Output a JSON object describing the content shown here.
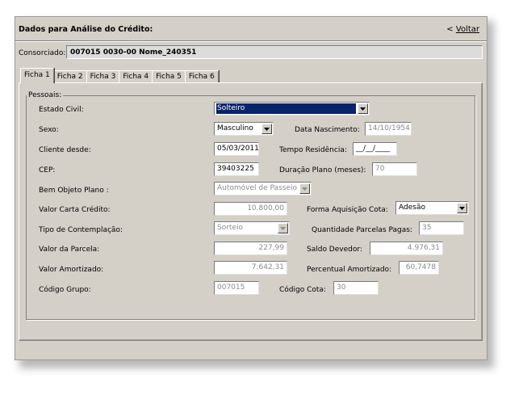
{
  "window": {
    "title": "Dados para Análise do Crédito:",
    "back_label": "Voltar",
    "back_glyph": "<"
  },
  "consorciado": {
    "label": "Consorciado:",
    "value": "007015 0030-00  Nome_240351"
  },
  "tabs": [
    {
      "label": "Ficha 1",
      "active": true
    },
    {
      "label": "Ficha 2"
    },
    {
      "label": "Ficha 3"
    },
    {
      "label": "Ficha 4"
    },
    {
      "label": "Ficha 5"
    },
    {
      "label": "Ficha 6"
    }
  ],
  "group": {
    "legend": "Pessoais:"
  },
  "fields": {
    "estado_civil": {
      "label": "Estado Civil:",
      "value": "Solteiro"
    },
    "sexo": {
      "label": "Sexo:",
      "value": "Masculino"
    },
    "data_nascimento": {
      "label": "Data Nascimento:",
      "value": "14/10/1954"
    },
    "cliente_desde": {
      "label": "Cliente desde:",
      "value": "05/03/2011"
    },
    "tempo_residencia": {
      "label": "Tempo Residência:",
      "value": "__/__/____"
    },
    "cep": {
      "label": "CEP:",
      "value": "39403225"
    },
    "duracao_plano": {
      "label": "Duração Plano (meses):",
      "value": "70"
    },
    "bem_objeto": {
      "label": "Bem Objeto Plano :",
      "value": "Automóvel de Passeio"
    },
    "valor_carta": {
      "label": "Valor Carta Crédito:",
      "value": "10.800,00"
    },
    "forma_aquisicao": {
      "label": "Forma Aquisição Cota:",
      "value": "Adesão"
    },
    "tipo_contemplacao": {
      "label": "Tipo de Contemplação:",
      "value": "Sorteio"
    },
    "qtd_parcelas": {
      "label": "Quantidade Parcelas Pagas:",
      "value": "35"
    },
    "valor_parcela": {
      "label": "Valor da Parcela:",
      "value": "227,99"
    },
    "saldo_devedor": {
      "label": "Saldo Devedor:",
      "value": "4.976,31"
    },
    "valor_amortizado": {
      "label": "Valor Amortizado:",
      "value": "7.642,31"
    },
    "percentual_amortizado": {
      "label": "Percentual Amortizado:",
      "value": "60,7478"
    },
    "codigo_grupo": {
      "label": "Código Grupo:",
      "value": "007015"
    },
    "codigo_cota": {
      "label": "Código Cota:",
      "value": "30"
    }
  }
}
